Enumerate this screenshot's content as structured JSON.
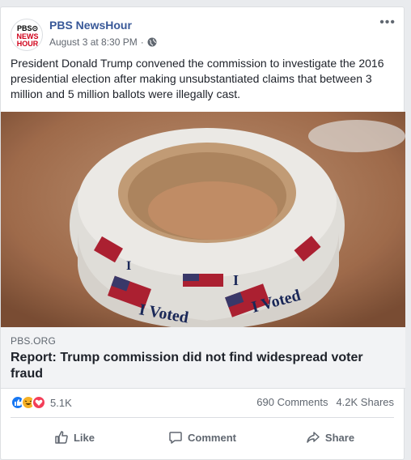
{
  "post": {
    "page_name": "PBS NewsHour",
    "timestamp": "August 3 at 8:30 PM",
    "separator": "·",
    "more_menu": "•••",
    "text": "President Donald Trump convened the commission to investigate the 2016 presidential election after making unsubstantiated claims that between 3 million and 5 million ballots were illegally cast.",
    "logo_lines": [
      "PBS",
      "NEWS",
      "HOUR"
    ]
  },
  "link": {
    "domain": "PBS.ORG",
    "headline": "Report: Trump commission did not find widespread voter fraud",
    "image_sticker_text": [
      "I Voted",
      "I Voted",
      "I",
      "I"
    ]
  },
  "stats": {
    "reaction_count": "5.1K",
    "comments": "690 Comments",
    "shares": "4.2K Shares"
  },
  "actions": {
    "like": "Like",
    "comment": "Comment",
    "share": "Share"
  },
  "colors": {
    "page_name": "#385898",
    "like_blue": "#1877f2",
    "haha_yellow": "#f7b125",
    "love_red": "#f33e58"
  }
}
